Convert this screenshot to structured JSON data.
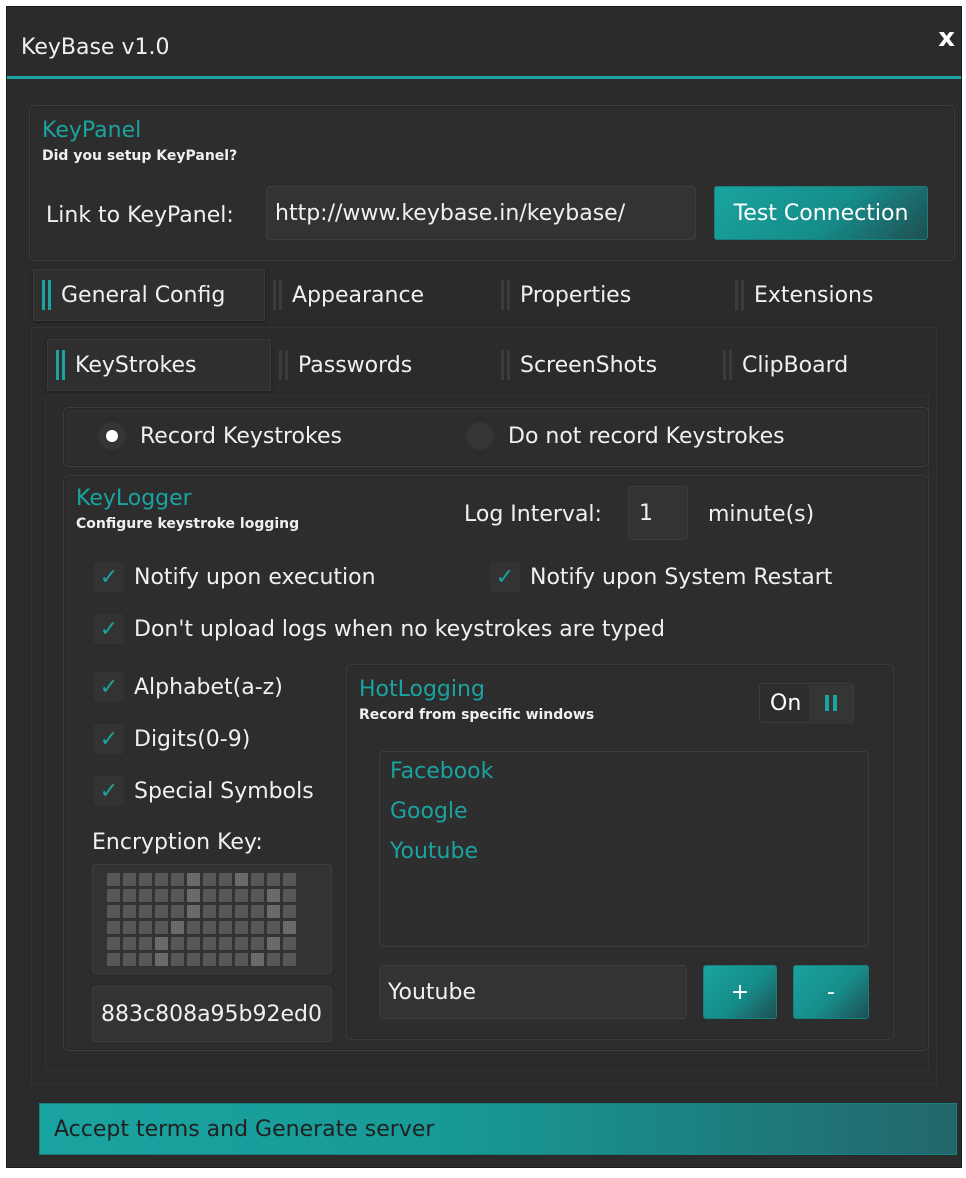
{
  "window": {
    "title": "KeyBase v1.0",
    "close_label": "x"
  },
  "keypanel": {
    "title": "KeyPanel",
    "subtitle": "Did you setup KeyPanel?",
    "link_label": "Link to KeyPanel:",
    "link_value": "http://www.keybase.in/keybase/",
    "test_button": "Test Connection"
  },
  "main_tabs": [
    {
      "label": "General Config",
      "active": true
    },
    {
      "label": "Appearance",
      "active": false
    },
    {
      "label": "Properties",
      "active": false
    },
    {
      "label": "Extensions",
      "active": false
    }
  ],
  "sub_tabs": [
    {
      "label": "KeyStrokes",
      "active": true
    },
    {
      "label": "Passwords",
      "active": false
    },
    {
      "label": "ScreenShots",
      "active": false
    },
    {
      "label": "ClipBoard",
      "active": false
    }
  ],
  "record": {
    "option_record": "Record Keystrokes",
    "option_no_record": "Do not record Keystrokes",
    "selected": "record"
  },
  "keylogger": {
    "title": "KeyLogger",
    "subtitle": "Configure keystroke logging",
    "interval_label": "Log Interval:",
    "interval_value": "1",
    "interval_unit": "minute(s)",
    "notify_execution": "Notify upon execution",
    "notify_restart": "Notify upon System Restart",
    "no_upload": "Don't upload logs when no keystrokes are typed",
    "alphabet": "Alphabet(a-z)",
    "digits": "Digits(0-9)",
    "symbols": "Special Symbols",
    "check_mark": "✓",
    "encryption_label": "Encryption Key:",
    "encryption_value": "883c808a95b92ed0"
  },
  "hotlogging": {
    "title": "HotLogging",
    "subtitle": "Record from specific windows",
    "toggle_label": "On",
    "windows": [
      "Facebook",
      "Google",
      "Youtube"
    ],
    "input_value": "Youtube",
    "add_label": "+",
    "remove_label": "-"
  },
  "footer": {
    "generate_label": "Accept terms and Generate server"
  },
  "colors": {
    "accent": "#1aa3a0",
    "background": "#2b2b2b"
  }
}
